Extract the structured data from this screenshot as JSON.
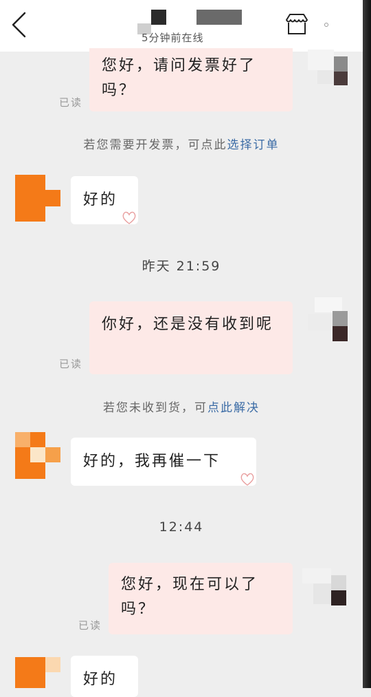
{
  "header": {
    "online_status": "5分钟前在线"
  },
  "messages": [
    {
      "type": "out",
      "text": "您好，请问发票好了吗？",
      "read": "已读"
    },
    {
      "type": "system",
      "text": "若您需要开发票，可点此",
      "link": "选择订单"
    },
    {
      "type": "in",
      "text": "好的"
    },
    {
      "type": "time",
      "text": "昨天 21:59"
    },
    {
      "type": "out",
      "text": "你好，还是没有收到呢",
      "read": "已读"
    },
    {
      "type": "system",
      "text": "若您未收到货，可",
      "link": "点此解决"
    },
    {
      "type": "in",
      "text": "好的，我再催一下"
    },
    {
      "type": "time",
      "text": "12:44"
    },
    {
      "type": "out",
      "text": "您好，现在可以了吗？",
      "read": "已读"
    },
    {
      "type": "in",
      "text": "好的"
    }
  ],
  "colors": {
    "outgoing_bubble": "#fde9e7",
    "incoming_bubble": "#ffffff",
    "link": "#3a6ba5",
    "seller_avatar": "#f47a18"
  },
  "icons": [
    "back-icon",
    "store-icon",
    "more-icon"
  ]
}
